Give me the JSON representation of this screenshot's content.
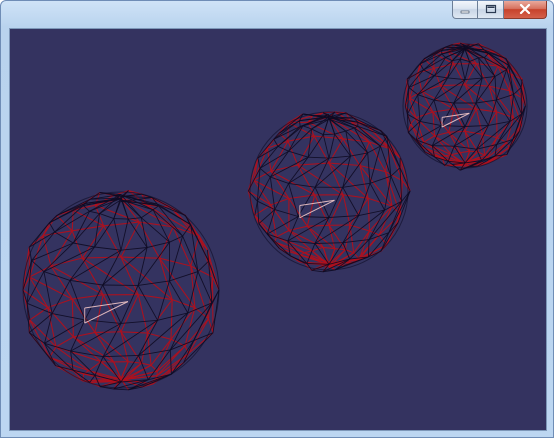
{
  "window": {
    "title": "",
    "controls": {
      "minimize": "minimize-icon",
      "maximize": "maximize-icon",
      "close": "close-icon"
    },
    "close_color": "#c7422b"
  },
  "viewport": {
    "background": "#343360",
    "wire_colors": {
      "outer": "#0e0b24",
      "inner": "#b0101c",
      "highlight": "#f2c6c6"
    },
    "spheres": [
      {
        "name": "sphere-large"
      },
      {
        "name": "sphere-medium"
      },
      {
        "name": "sphere-small"
      }
    ]
  }
}
